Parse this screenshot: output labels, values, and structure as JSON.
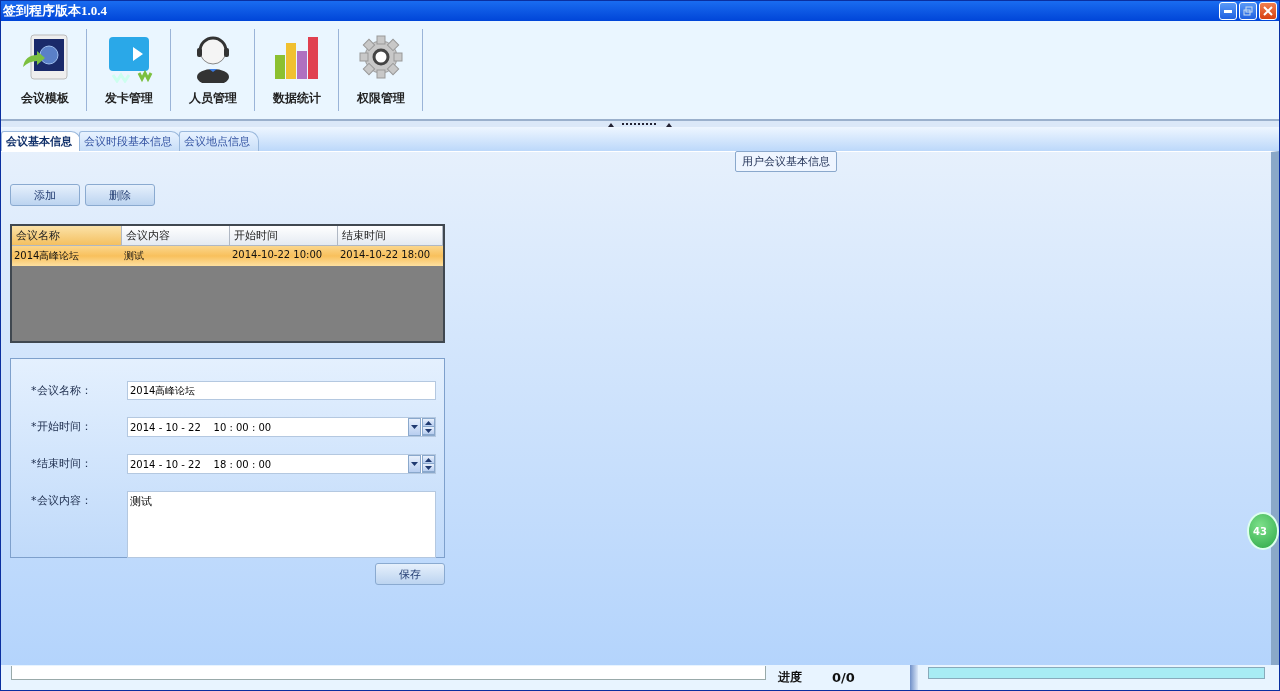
{
  "window": {
    "title": "签到程序版本1.0.4"
  },
  "toolbar": [
    {
      "label": "会议模板"
    },
    {
      "label": "发卡管理"
    },
    {
      "label": "人员管理"
    },
    {
      "label": "数据统计"
    },
    {
      "label": "权限管理"
    }
  ],
  "tabs": [
    {
      "label": "会议基本信息",
      "selected": true
    },
    {
      "label": "会议时段基本信息",
      "selected": false
    },
    {
      "label": "会议地点信息",
      "selected": false
    }
  ],
  "group_title": "用户会议基本信息",
  "actions": [
    "添加",
    "删除"
  ],
  "table": {
    "columns": [
      {
        "label": "会议名称",
        "selected": true
      },
      {
        "label": "会议内容",
        "selected": false
      },
      {
        "label": "开始时间",
        "selected": false
      },
      {
        "label": "结束时间",
        "selected": false
      }
    ],
    "rows": [
      {
        "cells": [
          "2014高峰论坛",
          "测试",
          "2014-10-22 10:00",
          "2014-10-22 18:00"
        ],
        "selected": true
      }
    ]
  },
  "form": {
    "fields": [
      {
        "kind": "text",
        "label": "*会议名称：",
        "value": "2014高峰论坛"
      },
      {
        "kind": "datetime",
        "label": "*开始时间：",
        "value": "2014 - 10 - 22    10 : 00 : 00"
      },
      {
        "kind": "datetime",
        "label": "*结束时间：",
        "value": "2014 - 10 - 22    18 : 00 : 00"
      },
      {
        "kind": "textarea",
        "label": "*会议内容：",
        "value": "测试"
      }
    ],
    "save": "保存"
  },
  "status_bar": {
    "progress_label": "进度",
    "progress_value": "0/0"
  },
  "badge": "43"
}
